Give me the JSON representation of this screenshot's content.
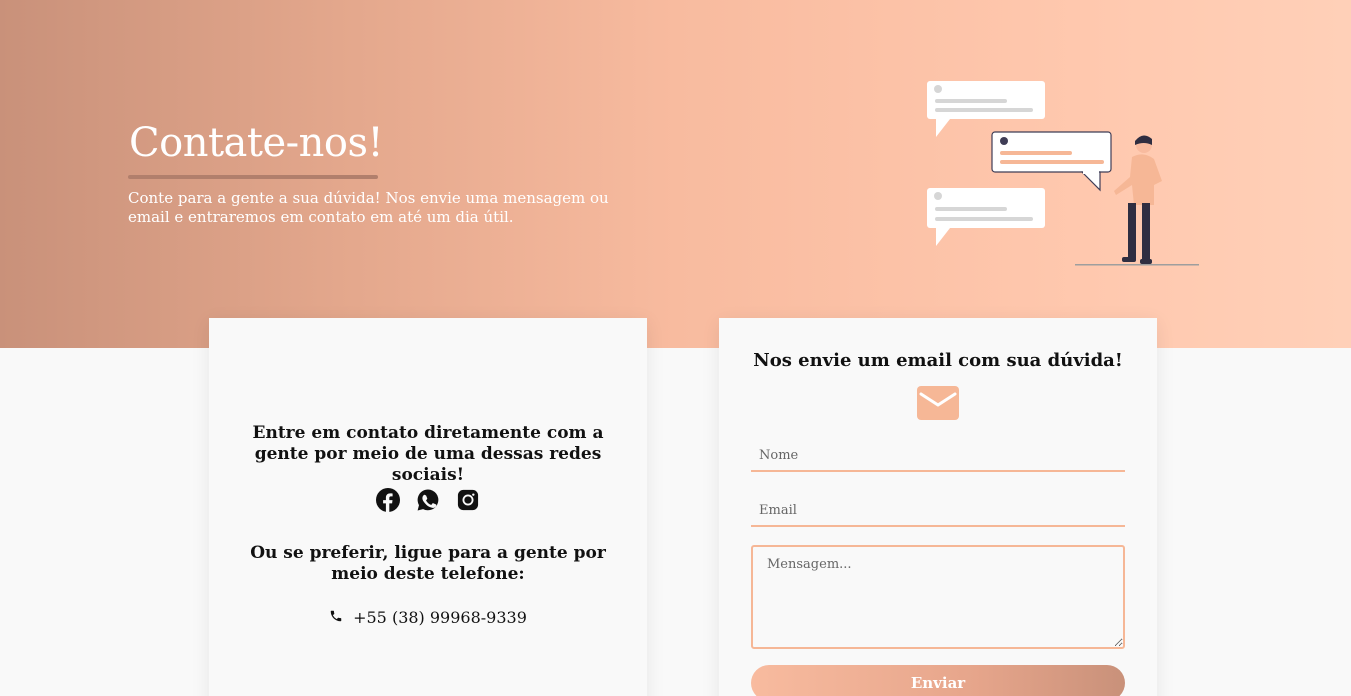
{
  "hero": {
    "title": "Contate-nos!",
    "subtitle": "Conte para a gente a sua dúvida! Nos envie uma mensagem ou email e entraremos em contato em até um dia útil."
  },
  "left_card": {
    "heading": "Entre em contato diretamente com a gente por meio de uma dessas redes sociais!",
    "social_icons": [
      "facebook-icon",
      "whatsapp-icon",
      "instagram-icon"
    ],
    "heading2": "Ou se preferir, ligue para a gente por meio deste telefone:",
    "phone": "+55 (38) 99968-9339"
  },
  "right_card": {
    "heading": "Nos envie um email com sua dúvida!",
    "name_placeholder": "Nome",
    "email_placeholder": "Email",
    "message_placeholder": "Mensagem...",
    "submit_label": "Enviar"
  },
  "colors": {
    "accent": "#f6b796",
    "underline": "#b17f6c",
    "hero_start": "#c9917a",
    "hero_end": "#ffd0b8"
  }
}
